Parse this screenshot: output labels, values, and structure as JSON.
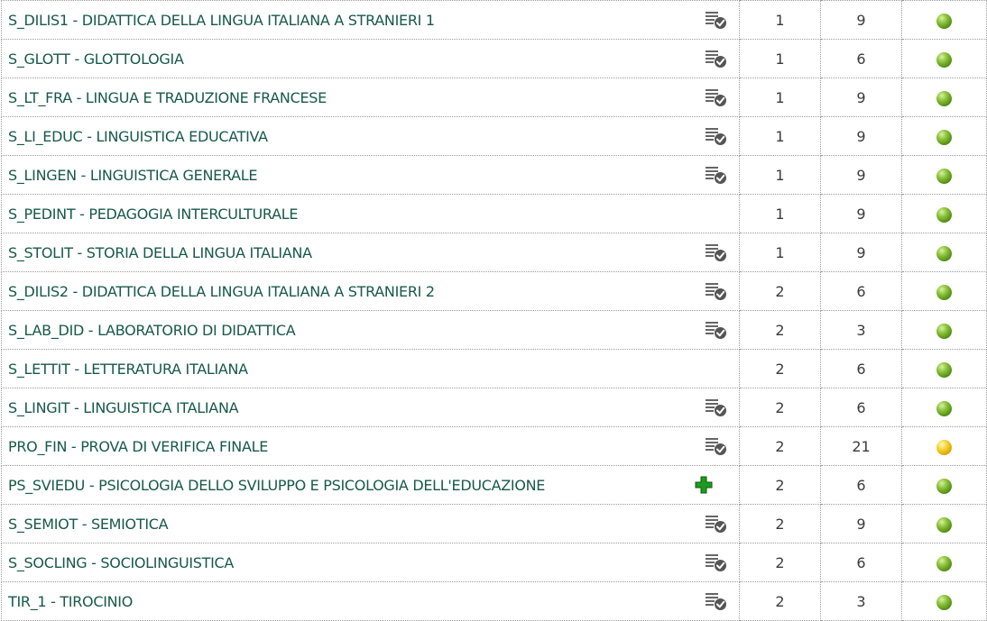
{
  "rows": [
    {
      "name": "S_DILIS1 - DIDATTICA DELLA LINGUA ITALIANA A STRANIERI 1",
      "icon": "list-check-icon",
      "year": "1",
      "cfu": "9",
      "status": "green"
    },
    {
      "name": "S_GLOTT - GLOTTOLOGIA",
      "icon": "list-check-icon",
      "year": "1",
      "cfu": "6",
      "status": "green"
    },
    {
      "name": "S_LT_FRA - LINGUA E TRADUZIONE FRANCESE",
      "icon": "list-check-icon",
      "year": "1",
      "cfu": "9",
      "status": "green"
    },
    {
      "name": "S_LI_EDUC - LINGUISTICA EDUCATIVA",
      "icon": "list-check-icon",
      "year": "1",
      "cfu": "9",
      "status": "green"
    },
    {
      "name": "S_LINGEN - LINGUISTICA GENERALE",
      "icon": "list-check-icon",
      "year": "1",
      "cfu": "9",
      "status": "green"
    },
    {
      "name": "S_PEDINT - PEDAGOGIA INTERCULTURALE",
      "icon": "",
      "year": "1",
      "cfu": "9",
      "status": "green"
    },
    {
      "name": "S_STOLIT - STORIA DELLA LINGUA ITALIANA",
      "icon": "list-check-icon",
      "year": "1",
      "cfu": "9",
      "status": "green"
    },
    {
      "name": "S_DILIS2 - DIDATTICA DELLA LINGUA ITALIANA A STRANIERI 2",
      "icon": "list-check-icon",
      "year": "2",
      "cfu": "6",
      "status": "green"
    },
    {
      "name": "S_LAB_DID - LABORATORIO DI DIDATTICA",
      "icon": "list-check-icon",
      "year": "2",
      "cfu": "3",
      "status": "green"
    },
    {
      "name": "S_LETTIT - LETTERATURA ITALIANA",
      "icon": "",
      "year": "2",
      "cfu": "6",
      "status": "green"
    },
    {
      "name": "S_LINGIT - LINGUISTICA ITALIANA",
      "icon": "list-check-icon",
      "year": "2",
      "cfu": "6",
      "status": "green"
    },
    {
      "name": "PRO_FIN - PROVA DI VERIFICA FINALE",
      "icon": "list-check-icon",
      "year": "2",
      "cfu": "21",
      "status": "yellow"
    },
    {
      "name": "PS_SVIEDU - PSICOLOGIA DELLO SVILUPPO E PSICOLOGIA DELL'EDUCAZIONE",
      "icon": "plus-icon",
      "year": "2",
      "cfu": "6",
      "status": "green"
    },
    {
      "name": "S_SEMIOT - SEMIOTICA",
      "icon": "list-check-icon",
      "year": "2",
      "cfu": "9",
      "status": "green"
    },
    {
      "name": "S_SOCLING - SOCIOLINGUISTICA",
      "icon": "list-check-icon",
      "year": "2",
      "cfu": "6",
      "status": "green"
    },
    {
      "name": "TIR_1 - TIROCINIO",
      "icon": "list-check-icon",
      "year": "2",
      "cfu": "3",
      "status": "green"
    }
  ],
  "colors": {
    "link": "#17594b",
    "status_green": "#5f9a1a",
    "status_yellow": "#f0c21e",
    "plus_icon": "#1e9a1e",
    "list_icon": "#666666"
  }
}
